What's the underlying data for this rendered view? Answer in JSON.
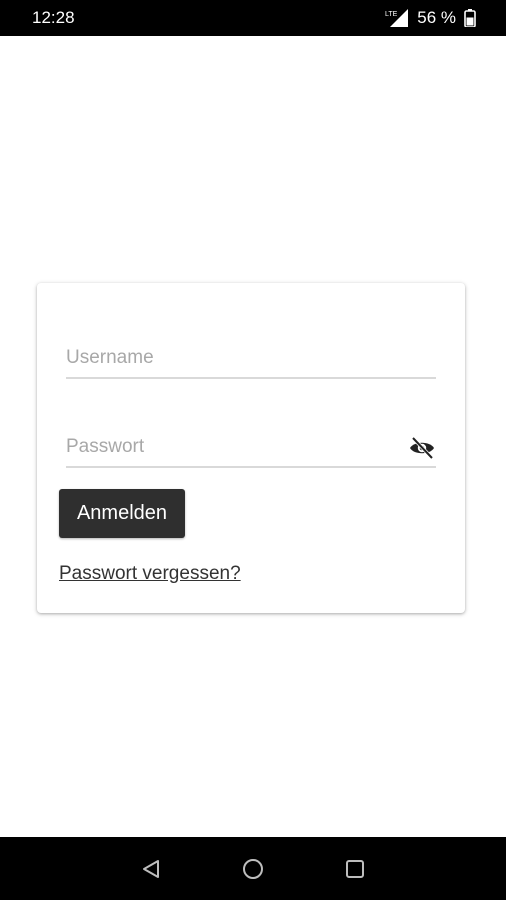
{
  "status_bar": {
    "time": "12:28",
    "battery": "56 %",
    "network_label": "LTE"
  },
  "login": {
    "username_placeholder": "Username",
    "password_placeholder": "Passwort",
    "login_label": "Anmelden",
    "forgot_label": "Passwort vergessen?"
  },
  "icons": {
    "signal": "signal-icon",
    "battery": "battery-icon",
    "visibility": "visibility-off-icon",
    "back": "back-icon",
    "home": "home-icon",
    "recents": "recents-icon"
  },
  "colors": {
    "button_bg": "#2f2f2f",
    "underline": "#d9d9d9"
  }
}
